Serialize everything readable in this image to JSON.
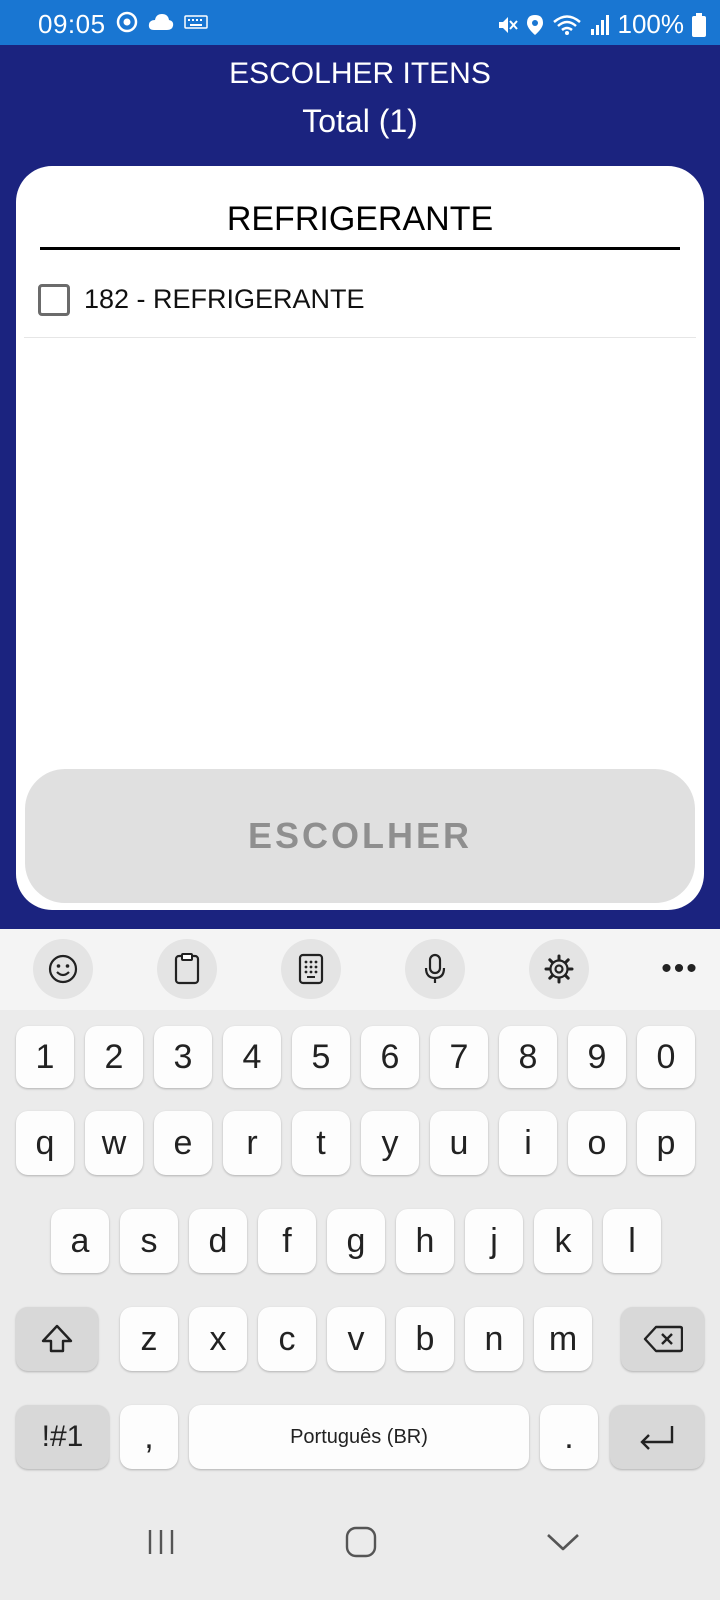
{
  "status_bar": {
    "time": "09:05",
    "battery": "100%",
    "icons_left": [
      "target-icon",
      "cloud-icon",
      "keyboard-icon"
    ],
    "icons_right": [
      "mute-vibrate-icon",
      "location-icon",
      "wifi-icon",
      "signal-icon",
      "battery-icon"
    ]
  },
  "header": {
    "title": "ESCOLHER ITENS",
    "total": "Total (1)"
  },
  "search": {
    "value": "REFRIGERANTE"
  },
  "list": {
    "items": [
      {
        "label": "182 - REFRIGERANTE",
        "checked": false
      }
    ]
  },
  "actions": {
    "choose_label": "ESCOLHER"
  },
  "keyboard": {
    "toolbar": [
      "emoji-icon",
      "clipboard-icon",
      "keypad-icon",
      "microphone-icon",
      "settings-icon",
      "more-icon"
    ],
    "more_label": "•••",
    "row_numbers": [
      "1",
      "2",
      "3",
      "4",
      "5",
      "6",
      "7",
      "8",
      "9",
      "0"
    ],
    "row_1": [
      "q",
      "w",
      "e",
      "r",
      "t",
      "y",
      "u",
      "i",
      "o",
      "p"
    ],
    "row_2": [
      "a",
      "s",
      "d",
      "f",
      "g",
      "h",
      "j",
      "k",
      "l"
    ],
    "row_3": [
      "z",
      "x",
      "c",
      "v",
      "b",
      "n",
      "m"
    ],
    "symbols_label": "!#1",
    "comma_label": ",",
    "space_label": "Português (BR)",
    "period_label": "."
  },
  "nav": [
    "recents-icon",
    "home-icon",
    "back-icon"
  ],
  "colors": {
    "status_bar": "#1976d2",
    "header_bg": "#1b237f",
    "card_bg": "#ffffff",
    "button_disabled_bg": "#e0e0e0",
    "button_disabled_text": "#8f8f8f"
  }
}
